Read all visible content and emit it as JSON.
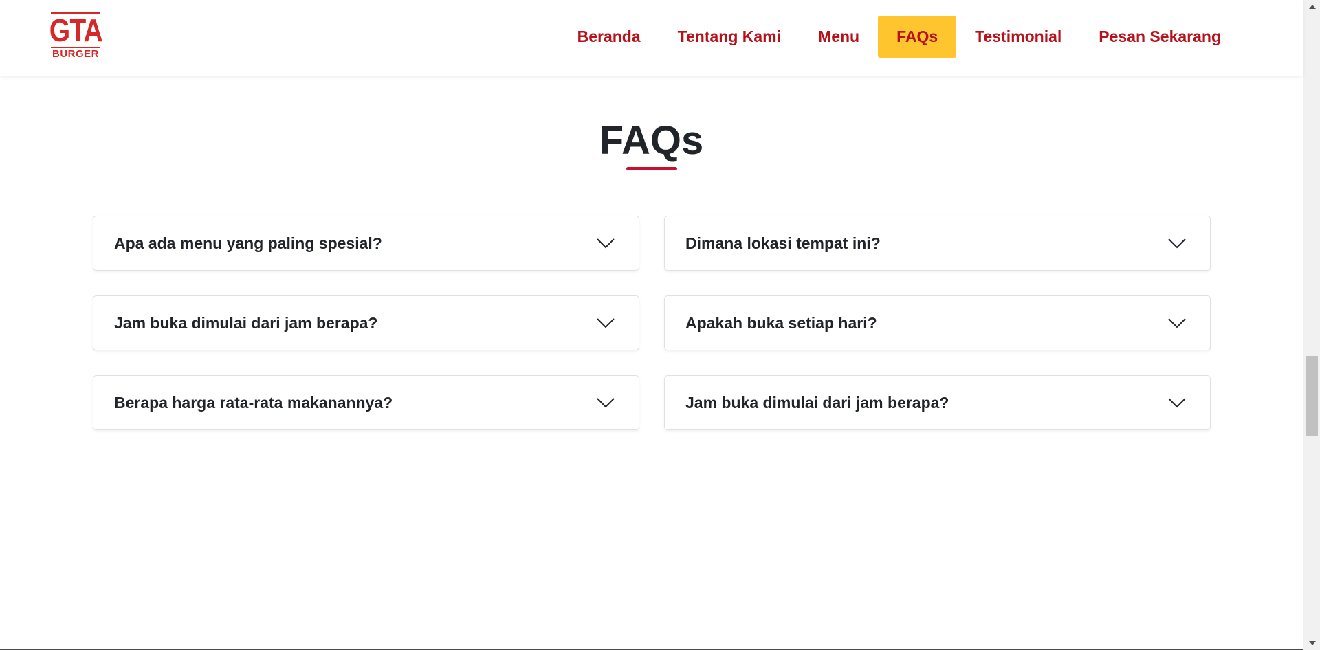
{
  "brand": {
    "logo_main": "GTA",
    "logo_sub": "BURGER",
    "color": "#d62828"
  },
  "nav": {
    "items": [
      {
        "label": "Beranda",
        "active": false
      },
      {
        "label": "Tentang Kami",
        "active": false
      },
      {
        "label": "Menu",
        "active": false
      },
      {
        "label": "FAQs",
        "active": true
      },
      {
        "label": "Testimonial",
        "active": false
      },
      {
        "label": "Pesan Sekarang",
        "active": false
      }
    ],
    "link_color": "#b5121b",
    "active_bg": "#fec52e"
  },
  "faq": {
    "title": "FAQs",
    "underline_color": "#c8102e",
    "items": [
      {
        "question": "Apa ada menu yang paling spesial?",
        "icon": "chevron-down-icon"
      },
      {
        "question": "Dimana lokasi tempat ini?",
        "icon": "chevron-down-icon"
      },
      {
        "question": "Jam buka dimulai dari jam berapa?",
        "icon": "chevron-down-icon"
      },
      {
        "question": "Apakah buka setiap hari?",
        "icon": "chevron-down-icon"
      },
      {
        "question": "Berapa harga rata-rata makanannya?",
        "icon": "chevron-down-icon"
      },
      {
        "question": "Jam buka dimulai dari jam berapa?",
        "icon": "chevron-down-icon"
      }
    ]
  }
}
